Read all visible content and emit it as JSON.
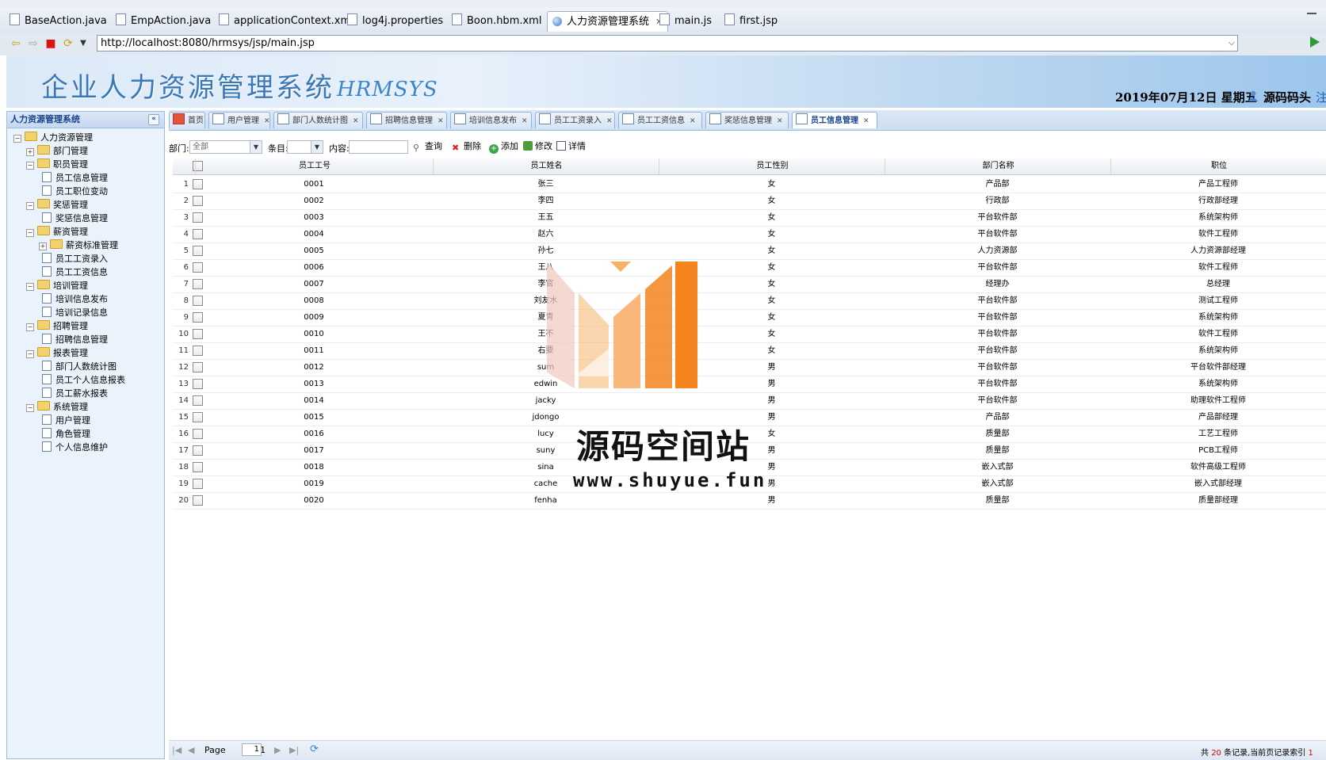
{
  "ide_tabs": [
    {
      "label": "BaseAction.java",
      "active": false
    },
    {
      "label": "EmpAction.java",
      "active": false
    },
    {
      "label": "applicationContext.xml",
      "active": false
    },
    {
      "label": "log4j.properties",
      "active": false
    },
    {
      "label": "Boon.hbm.xml",
      "active": false
    },
    {
      "label": "人力资源管理系统",
      "active": true,
      "close": "✕"
    },
    {
      "label": "main.js",
      "active": false
    },
    {
      "label": "first.jsp",
      "active": false
    }
  ],
  "browser": {
    "url": "http://localhost:8080/hrmsys/jsp/main.jsp"
  },
  "banner": {
    "title": "企业人力资源管理系统",
    "subtitle": "HRMSYS",
    "date": "2019年07月12日 星期五",
    "user": "源码码头",
    "logout": "注销"
  },
  "sidebar": {
    "title": "人力资源管理系统",
    "collapse": "«",
    "nodes": [
      {
        "label": "人力资源管理",
        "type": "folder",
        "expander": "−"
      },
      {
        "label": "部门管理",
        "type": "folder",
        "expander": "+"
      },
      {
        "label": "职员管理",
        "type": "folder",
        "expander": "−"
      },
      {
        "label": "员工信息管理",
        "type": "leaf"
      },
      {
        "label": "员工职位变动",
        "type": "leaf"
      },
      {
        "label": "奖惩管理",
        "type": "folder",
        "expander": "−"
      },
      {
        "label": "奖惩信息管理",
        "type": "leaf"
      },
      {
        "label": "薪资管理",
        "type": "folder",
        "expander": "−"
      },
      {
        "label": "薪资标准管理",
        "type": "folder",
        "expander": "+"
      },
      {
        "label": "员工工资录入",
        "type": "leaf"
      },
      {
        "label": "员工工资信息",
        "type": "leaf"
      },
      {
        "label": "培训管理",
        "type": "folder",
        "expander": "−"
      },
      {
        "label": "培训信息发布",
        "type": "leaf"
      },
      {
        "label": "培训记录信息",
        "type": "leaf"
      },
      {
        "label": "招聘管理",
        "type": "folder",
        "expander": "−"
      },
      {
        "label": "招聘信息管理",
        "type": "leaf"
      },
      {
        "label": "报表管理",
        "type": "folder",
        "expander": "−"
      },
      {
        "label": "部门人数统计图",
        "type": "leaf"
      },
      {
        "label": "员工个人信息报表",
        "type": "leaf"
      },
      {
        "label": "员工薪水报表",
        "type": "leaf"
      },
      {
        "label": "系统管理",
        "type": "folder",
        "expander": "−"
      },
      {
        "label": "用户管理",
        "type": "leaf"
      },
      {
        "label": "角色管理",
        "type": "leaf"
      },
      {
        "label": "个人信息维护",
        "type": "leaf"
      }
    ]
  },
  "module_tabs": [
    {
      "label": "首页",
      "closable": false,
      "active": false
    },
    {
      "label": "用户管理",
      "closable": true,
      "active": false
    },
    {
      "label": "部门人数统计图",
      "closable": true,
      "active": false
    },
    {
      "label": "招聘信息管理",
      "closable": true,
      "active": false
    },
    {
      "label": "培训信息发布",
      "closable": true,
      "active": false
    },
    {
      "label": "员工工资录入",
      "closable": true,
      "active": false
    },
    {
      "label": "员工工资信息",
      "closable": true,
      "active": false
    },
    {
      "label": "奖惩信息管理",
      "closable": true,
      "active": false
    },
    {
      "label": "员工信息管理",
      "closable": true,
      "active": true
    }
  ],
  "toolbar": {
    "dept_label": "部门:",
    "dept_value": "全部",
    "field_label": "条目:",
    "field_value": "",
    "content_label": "内容:",
    "content_value": "",
    "query": "查询",
    "delete": "删除",
    "add": "添加",
    "edit": "修改",
    "detail": "详情"
  },
  "grid": {
    "columns": [
      "员工工号",
      "员工姓名",
      "员工性别",
      "部门名称",
      "职位"
    ],
    "rows": [
      [
        "0001",
        "张三",
        "女",
        "产品部",
        "产品工程师"
      ],
      [
        "0002",
        "李四",
        "女",
        "行政部",
        "行政部经理"
      ],
      [
        "0003",
        "王五",
        "女",
        "平台软件部",
        "系统架构师"
      ],
      [
        "0004",
        "赵六",
        "女",
        "平台软件部",
        "软件工程师"
      ],
      [
        "0005",
        "孙七",
        "女",
        "人力资源部",
        "人力资源部经理"
      ],
      [
        "0006",
        "王八",
        "女",
        "平台软件部",
        "软件工程师"
      ],
      [
        "0007",
        "李官",
        "女",
        "经理办",
        "总经理"
      ],
      [
        "0008",
        "刘友水",
        "女",
        "平台软件部",
        "测试工程师"
      ],
      [
        "0009",
        "夏青",
        "女",
        "平台软件部",
        "系统架构师"
      ],
      [
        "0010",
        "王不",
        "女",
        "平台软件部",
        "软件工程师"
      ],
      [
        "0011",
        "右要",
        "女",
        "平台软件部",
        "系统架构师"
      ],
      [
        "0012",
        "sum",
        "男",
        "平台软件部",
        "平台软件部经理"
      ],
      [
        "0013",
        "edwin",
        "男",
        "平台软件部",
        "系统架构师"
      ],
      [
        "0014",
        "jacky",
        "男",
        "平台软件部",
        "助理软件工程师"
      ],
      [
        "0015",
        "jdongo",
        "男",
        "产品部",
        "产品部经理"
      ],
      [
        "0016",
        "lucy",
        "女",
        "质量部",
        "工艺工程师"
      ],
      [
        "0017",
        "suny",
        "男",
        "质量部",
        "PCB工程师"
      ],
      [
        "0018",
        "sina",
        "男",
        "嵌入式部",
        "软件高级工程师"
      ],
      [
        "0019",
        "cache",
        "男",
        "嵌入式部",
        "嵌入式部经理"
      ],
      [
        "0020",
        "fenha",
        "男",
        "质量部",
        "质量部经理"
      ]
    ]
  },
  "pager": {
    "page_label": "Page",
    "page_value": "1",
    "of_label": "of 1",
    "summary_prefix": "共",
    "summary_count": "20",
    "summary_suffix": "条记录,当前页记录索引",
    "summary_tail": "1"
  },
  "watermark": {
    "title": "源码空间站",
    "url": "www.shuyue.fun"
  },
  "colors": {
    "accent": "#15428b",
    "watermark_orange": "#f5841f",
    "watermark_red": "#d9534f",
    "summary_red": "#e00000"
  }
}
